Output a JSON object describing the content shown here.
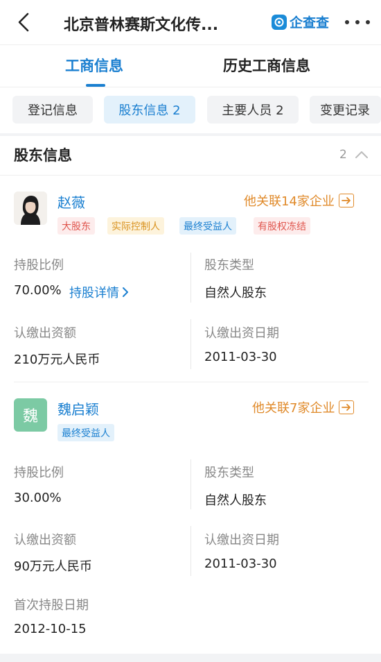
{
  "header": {
    "title": "北京普林赛斯文化传...",
    "brand": "企查查"
  },
  "tabs": {
    "active": "工商信息",
    "inactive": "历史工商信息"
  },
  "chips": [
    "登记信息",
    "股东信息 2",
    "主要人员 2",
    "变更记录"
  ],
  "section": {
    "title": "股东信息",
    "count": "2"
  },
  "shareholders": [
    {
      "name": "赵薇",
      "related": "他关联14家企业",
      "tags": [
        "大股东",
        "实际控制人",
        "最终受益人",
        "有股权冻结"
      ],
      "ratio_label": "持股比例",
      "ratio": "70.00%",
      "detail_link": "持股详情",
      "type_label": "股东类型",
      "type": "自然人股东",
      "amount_label": "认缴出资额",
      "amount": "210万元人民币",
      "date_label": "认缴出资日期",
      "date": "2011-03-30"
    },
    {
      "avatar_char": "魏",
      "name": "魏启颖",
      "related": "他关联7家企业",
      "tags": [
        "最终受益人"
      ],
      "ratio_label": "持股比例",
      "ratio": "30.00%",
      "type_label": "股东类型",
      "type": "自然人股东",
      "amount_label": "认缴出资额",
      "amount": "90万元人民币",
      "date_label": "认缴出资日期",
      "date": "2011-03-30",
      "first_date_label": "首次持股日期",
      "first_date": "2012-10-15"
    }
  ],
  "colors": {
    "accent": "#1a7fd0",
    "orange": "#e08a2a",
    "green_avatar": "#7ccaa4"
  }
}
